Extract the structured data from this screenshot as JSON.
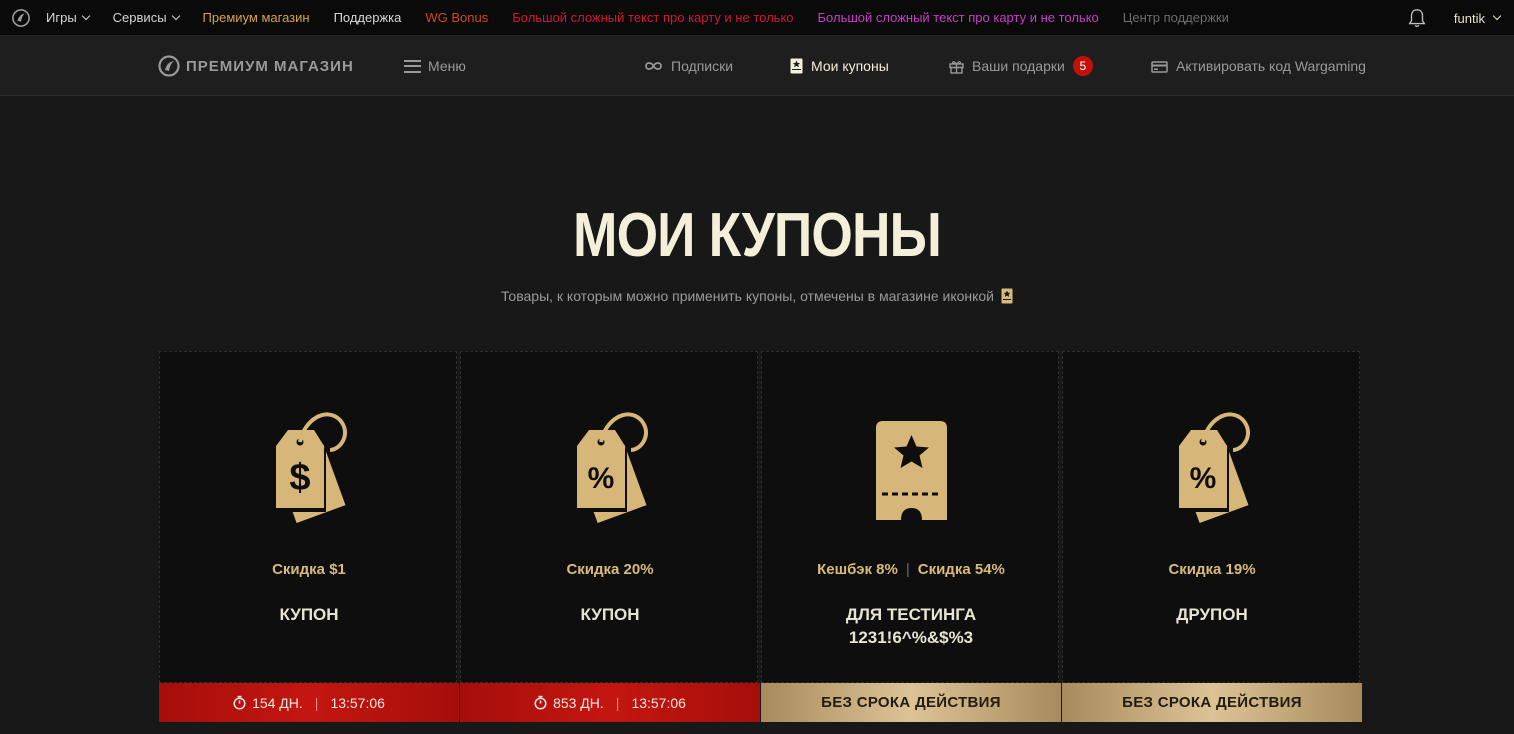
{
  "topbar": {
    "items": [
      {
        "label": "Игры",
        "color": "#d6d6d6",
        "dropdown": true
      },
      {
        "label": "Сервисы",
        "color": "#d6d6d6",
        "dropdown": true
      },
      {
        "label": "Премиум магазин",
        "color": "#d7a24a"
      },
      {
        "label": "Поддержка",
        "color": "#d6d6d6"
      },
      {
        "label": "WG Bonus",
        "color": "#d04a1e"
      },
      {
        "label": "Большой сложный текст про карту и не только",
        "color": "#d0183a"
      },
      {
        "label": "Большой сложный текст про карту и не только",
        "color": "#c83ec8"
      },
      {
        "label": "Центр поддержки",
        "color": "#6c6c6c"
      }
    ],
    "user": "funtik"
  },
  "subnav": {
    "brand": "Премиум магазин",
    "menu": "Меню",
    "subscriptions": "Подписки",
    "my_coupons": "Мои купоны",
    "gifts": "Ваши подарки",
    "gifts_count": "5",
    "activate": "Активировать код Wargaming"
  },
  "page": {
    "title": "МОИ КУПОНЫ",
    "subtitle": "Товары, к которым можно применить купоны, отмечены в магазине иконкой"
  },
  "coupons": [
    {
      "icon": "dollar-tag-icon",
      "discount": "Скидка $1",
      "name": "КУПОН",
      "footer_type": "red",
      "days": "154 ДН.",
      "time": "13:57:06"
    },
    {
      "icon": "percent-tag-icon",
      "discount": "Скидка 20%",
      "name": "КУПОН",
      "footer_type": "red",
      "days": "853 ДН.",
      "time": "13:57:06"
    },
    {
      "icon": "star-ticket-icon",
      "cashback": "Кешбэк 8%",
      "discount": "Скидка 54%",
      "name": "ДЛЯ ТЕСТИНГА 1231!6^%&$%3",
      "footer_type": "gold",
      "footer_text": "БЕЗ СРОКА ДЕЙСТВИЯ"
    },
    {
      "icon": "percent-tag-icon",
      "discount": "Скидка 19%",
      "name": "ДРУПОН",
      "footer_type": "gold",
      "footer_text": "БЕЗ СРОКА ДЕЙСТВИЯ"
    }
  ],
  "colors": {
    "gold": "#d9ba7c",
    "red": "#c41610",
    "background": "#181818"
  }
}
